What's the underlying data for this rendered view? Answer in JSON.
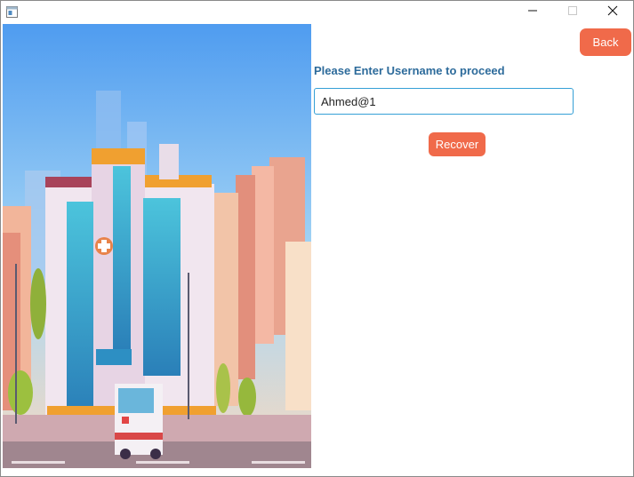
{
  "window": {
    "icon": "app-window-icon",
    "controls": [
      "minimize-icon",
      "maximize-icon",
      "close-icon"
    ]
  },
  "illustration": {
    "description_icon": "hospital-illustration"
  },
  "form": {
    "back_label": "Back",
    "prompt": "Please Enter Username to proceed",
    "username_value": "Ahmed@1",
    "recover_label": "Recover"
  },
  "colors": {
    "accent_button": "#f06a4a",
    "prompt_text": "#2d6b9b",
    "input_focus_border": "#35a0d6"
  }
}
